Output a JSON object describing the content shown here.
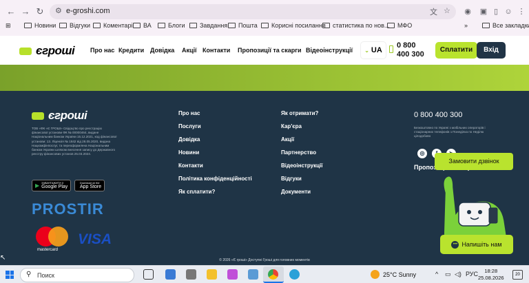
{
  "browser": {
    "url": "e-groshi.com",
    "bookmarks": [
      "Новини",
      "Відгуки",
      "Коментарі",
      "ВА",
      "Блоги",
      "Завдання",
      "Пошта",
      "Корисні посилання",
      "статистика по нов...",
      "МФО"
    ],
    "all_bookmarks": "Все закладки"
  },
  "header": {
    "logo_text": "єгроші",
    "nav": [
      "Про нас",
      "Кредити",
      "Довідка",
      "Акції",
      "Контакти",
      "Пропозиції та скарги",
      "Відеоінструкції"
    ],
    "lang": "UA",
    "phone_line1": "0 800",
    "phone_line2": "400 300",
    "pay_label": "Сплатити",
    "login_label": "Вхід"
  },
  "footer": {
    "logo_text": "єгроші",
    "legal": "ТОВ «ФК «Є ГРОШІ» Свідоцтво про реєстрацію фінансової установи ФК № 00000464, видане Національним банком України 15.12.2021, код фінансової установи: 13. Ліцензія № 1842 від 28.05.2020, видана Нацкомфінпослуг, та переоформлена Національним банком України шляхом внесення запису до Державного реєстру фінансових установ 25.03.2024.",
    "google_play_small": "ЗАВАНТАЖИТИ З",
    "google_play": "Google Play",
    "app_store_small": "Download on the",
    "app_store": "App Store",
    "prostir": "PROSTIR",
    "mastercard": "mastercard",
    "visa": "VISA",
    "col1": [
      "Про нас",
      "Послуги",
      "Довідка",
      "Новини",
      "Контакти",
      "Політика конфіденційності",
      "Як сплатити?"
    ],
    "col2": [
      "Як отримати?",
      "Кар'єра",
      "Акції",
      "Партнерство",
      "Відеоінструкції",
      "Відгуки",
      "Документи"
    ],
    "phone": "0 800 400 300",
    "phone_note": "Безкоштовно по Україні з мобільних операторів і стаціонарних телефонів з Понеділка по Неділю цілодобово",
    "social": [
      "instagram-icon",
      "facebook-icon",
      "telegram-icon"
    ],
    "proposals": "Пропозиції та скарги",
    "call_button": "Замовити дзвінок",
    "write_button": "Напишіть нам",
    "copyright": "© 2026 «Є гроші» Доступні Гроші для головних моментів"
  },
  "taskbar": {
    "search": "Поиск",
    "weather": "25°C  Sunny",
    "lang": "РУС",
    "time": "18:28",
    "date": "25.08.2026",
    "notifications": "20"
  },
  "colors": {
    "accent": "#b9e32e",
    "footer_bg": "#1f3446",
    "login_bg": "#213446"
  }
}
